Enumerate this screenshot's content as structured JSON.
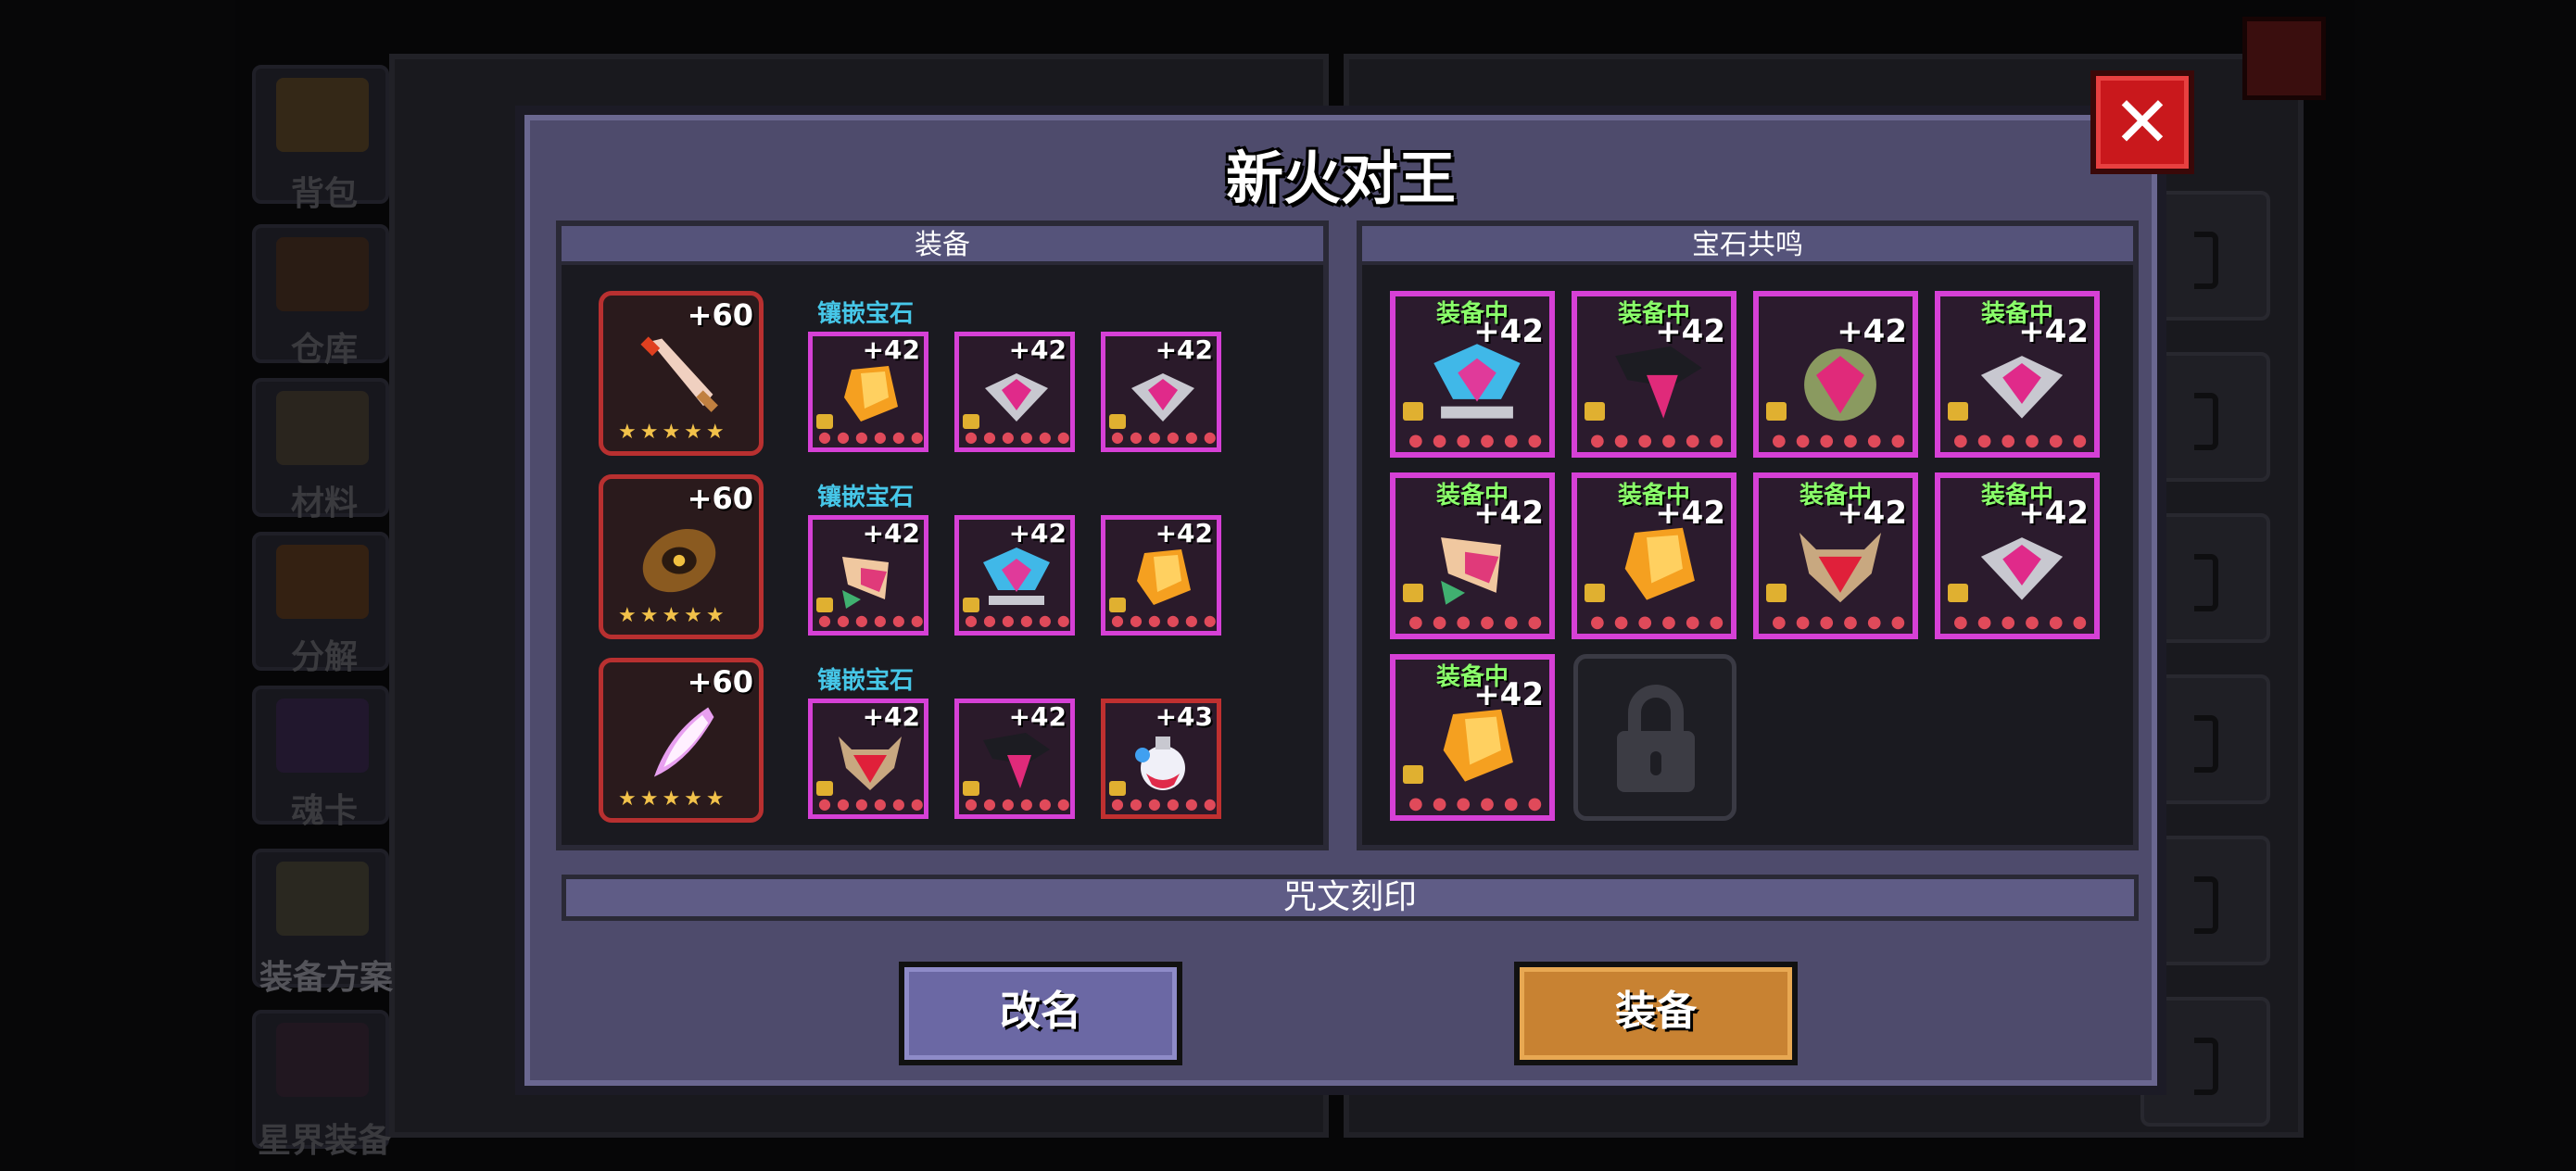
{
  "background": {
    "sidebar": [
      {
        "label": "背包"
      },
      {
        "label": "仓库"
      },
      {
        "label": "材料"
      },
      {
        "label": "分解"
      },
      {
        "label": "魂卡"
      },
      {
        "label": "装备方案"
      },
      {
        "label": "星界装备"
      }
    ]
  },
  "dialog": {
    "title": "新火对王",
    "equipment_section": {
      "header": "装备",
      "rows": [
        {
          "gear": {
            "plus": "+60",
            "stars": "★★★★★"
          },
          "inlay_label": "镶嵌宝石",
          "gems": [
            {
              "plus": "+42"
            },
            {
              "plus": "+42"
            },
            {
              "plus": "+42"
            }
          ]
        },
        {
          "gear": {
            "plus": "+60",
            "stars": "★★★★★"
          },
          "inlay_label": "镶嵌宝石",
          "gems": [
            {
              "plus": "+42"
            },
            {
              "plus": "+42"
            },
            {
              "plus": "+42"
            }
          ]
        },
        {
          "gear": {
            "plus": "+60",
            "stars": "★★★★★"
          },
          "inlay_label": "镶嵌宝石",
          "gems": [
            {
              "plus": "+42"
            },
            {
              "plus": "+42"
            },
            {
              "plus": "+43"
            }
          ]
        }
      ]
    },
    "resonance_section": {
      "header": "宝石共鸣",
      "slots": [
        {
          "status": "装备中",
          "plus": "+42"
        },
        {
          "status": "装备中",
          "plus": "+42"
        },
        {
          "status": "",
          "plus": "+42"
        },
        {
          "status": "装备中",
          "plus": "+42"
        },
        {
          "status": "装备中",
          "plus": "+42"
        },
        {
          "status": "装备中",
          "plus": "+42"
        },
        {
          "status": "装备中",
          "plus": "+42"
        },
        {
          "status": "装备中",
          "plus": "+42"
        },
        {
          "status": "装备中",
          "plus": "+42"
        }
      ]
    },
    "rune_bar": "咒文刻印",
    "rename_button": "改名",
    "equip_button": "装备"
  },
  "colors": {
    "close": "#c9181c",
    "equip": "#c88232",
    "rename": "#6b68a4",
    "gem_border": "#d640d6",
    "equipped_text": "#8aff6a",
    "inlay_text": "#46c7e8"
  }
}
